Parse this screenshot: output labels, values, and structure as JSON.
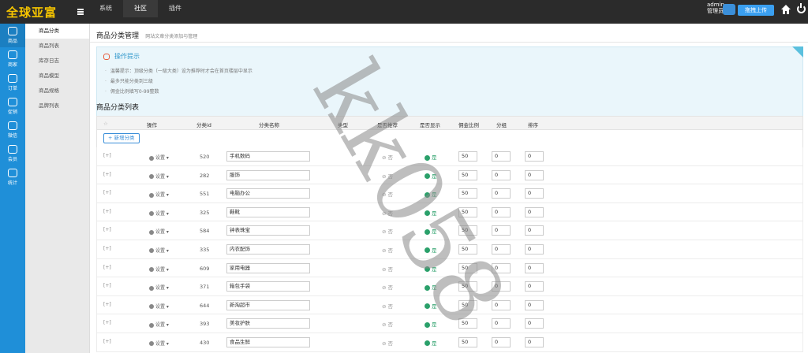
{
  "header": {
    "logo": "全球亚富",
    "nav": [
      "系统",
      "社区",
      "插件"
    ],
    "active_nav": "社区",
    "admin_name": "admin",
    "admin_role": "管理员",
    "upload_label": "拖拽上传"
  },
  "left_sidebar": [
    {
      "label": "商品",
      "icon": "goods-icon"
    },
    {
      "label": "商家",
      "icon": "store-icon"
    },
    {
      "label": "订单",
      "icon": "order-icon"
    },
    {
      "label": "促销",
      "icon": "promotion-icon"
    },
    {
      "label": "微信",
      "icon": "wechat-icon"
    },
    {
      "label": "会员",
      "icon": "member-icon"
    },
    {
      "label": "统计",
      "icon": "stats-icon"
    }
  ],
  "sub_nav": [
    "商品分类",
    "商品列表",
    "库存日志",
    "商品模型",
    "商品规格",
    "品牌列表"
  ],
  "page": {
    "title": "商品分类管理",
    "subtitle": "网站文章分类添加与管理",
    "tips_title": "操作提示",
    "tips": [
      "温馨提示：顶级分类（一级大类）设为推荐时才会在首页楼层中显示",
      "最多只能分类到三级",
      "佣金比例填写0-99整数"
    ],
    "list_title": "商品分类列表",
    "add_button": "新增分类"
  },
  "table": {
    "headers": {
      "star": "☆",
      "ops": "操作",
      "id": "分类id",
      "name": "分类名称",
      "type": "类型",
      "recommend": "是否推荐",
      "show": "是否显示",
      "commission": "佣金比例",
      "group": "分组",
      "sort": "排序"
    },
    "ops_label": "设置",
    "expand_label": "[+]",
    "rows": [
      {
        "id": "520",
        "name": "手机数码",
        "rec": "否",
        "show": "是",
        "commission": "50",
        "group": "0",
        "sort": "0"
      },
      {
        "id": "282",
        "name": "服饰",
        "rec": "否",
        "show": "是",
        "commission": "50",
        "group": "0",
        "sort": "0"
      },
      {
        "id": "551",
        "name": "电脑办公",
        "rec": "否",
        "show": "是",
        "commission": "50",
        "group": "0",
        "sort": "0"
      },
      {
        "id": "325",
        "name": "鞋靴",
        "rec": "否",
        "show": "是",
        "commission": "50",
        "group": "0",
        "sort": "0"
      },
      {
        "id": "584",
        "name": "钟表珠宝",
        "rec": "否",
        "show": "是",
        "commission": "50",
        "group": "0",
        "sort": "0"
      },
      {
        "id": "335",
        "name": "内衣配饰",
        "rec": "否",
        "show": "是",
        "commission": "50",
        "group": "0",
        "sort": "0"
      },
      {
        "id": "609",
        "name": "家用电器",
        "rec": "否",
        "show": "是",
        "commission": "50",
        "group": "0",
        "sort": "0"
      },
      {
        "id": "371",
        "name": "箱包手袋",
        "rec": "否",
        "show": "是",
        "commission": "50",
        "group": "0",
        "sort": "0"
      },
      {
        "id": "644",
        "name": "新淘超市",
        "rec": "否",
        "show": "是",
        "commission": "50",
        "group": "0",
        "sort": "0"
      },
      {
        "id": "393",
        "name": "美妆护肤",
        "rec": "否",
        "show": "是",
        "commission": "50",
        "group": "0",
        "sort": "0"
      },
      {
        "id": "430",
        "name": "食品生鲜",
        "rec": "否",
        "show": "是",
        "commission": "50",
        "group": "0",
        "sort": "0"
      }
    ]
  },
  "watermark": "kk058"
}
